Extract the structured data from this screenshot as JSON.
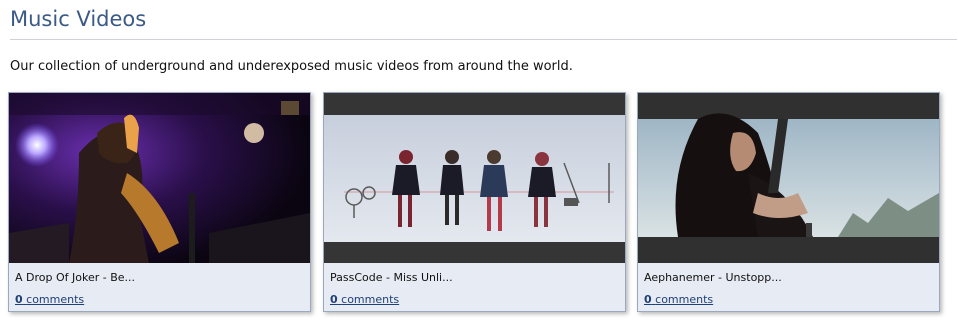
{
  "page": {
    "title": "Music Videos",
    "intro": "Our collection of underground and underexposed music videos from around the world."
  },
  "videos": [
    {
      "title": "A Drop Of Joker - Be...",
      "comment_count": "0",
      "comment_label": "comments"
    },
    {
      "title": "PassCode - Miss Unli...",
      "comment_count": "0",
      "comment_label": "comments"
    },
    {
      "title": "Aephanemer - Unstopp...",
      "comment_count": "0",
      "comment_label": "comments"
    }
  ],
  "colors": {
    "title": "#3b5a86",
    "card_bg": "#e7ecf4",
    "card_border": "#9aa9bd",
    "link": "#1f3f76"
  }
}
